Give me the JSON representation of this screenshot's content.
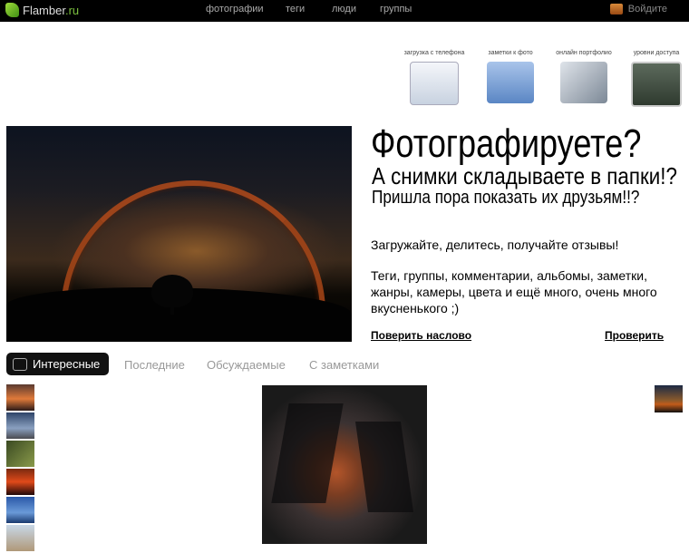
{
  "header": {
    "logo_name": "Flamber",
    "logo_tld": ".ru",
    "nav": [
      "фотографии",
      "теги",
      "люди",
      "группы"
    ],
    "login_label": "Войдите"
  },
  "features": [
    {
      "label": "загрузка с телефона",
      "icon": "phone-upload-icon",
      "color": "#dfe6f0"
    },
    {
      "label": "заметки к фото",
      "icon": "photo-notes-icon",
      "color": "#7fa6d8"
    },
    {
      "label": "онлайн портфолио",
      "icon": "portfolio-icon",
      "color": "#c4ccd6"
    },
    {
      "label": "уровни доступа",
      "icon": "access-levels-icon",
      "color": "#4a5a4a"
    }
  ],
  "hero": {
    "headline": "Фотографируете?",
    "line2": "А снимки складываете в папки!?",
    "line3": "Пришла пора показать их друзьям!!?",
    "para1": "Загружайте, делитесь, получайте отзывы!",
    "para2": "Теги, группы, комментарии, альбомы, заметки, жанры, камеры, цвета и ещё много, очень много вкусненького ;)",
    "link_trust": "Поверить наслово",
    "link_check": "Проверить"
  },
  "tabs": [
    "Интересные",
    "Последние",
    "Обсуждаемые",
    "С заметками"
  ],
  "thumbs": [
    "#6b3b28",
    "#3c4e78",
    "#4a5a2c",
    "#a43a1a",
    "#3a6ab0",
    "#c9b8a0"
  ]
}
